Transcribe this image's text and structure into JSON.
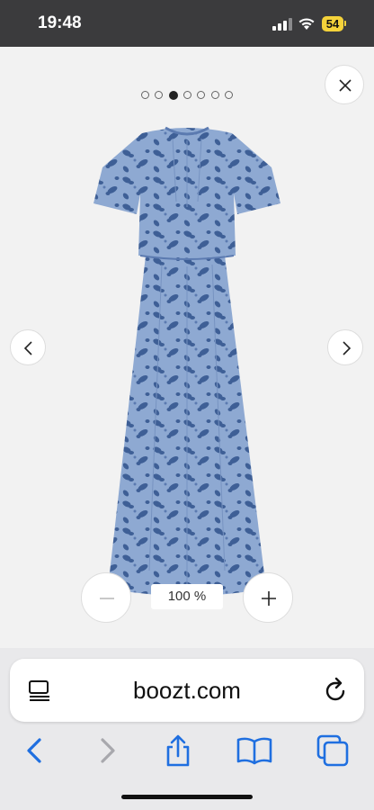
{
  "status_bar": {
    "time": "19:48",
    "battery_level": "54",
    "battery_color": "#f4d23a"
  },
  "gallery": {
    "image_count": 7,
    "active_index": 2,
    "image_alt": "Blue floral midi dress",
    "icons": {
      "close": "close-icon",
      "prev": "chevron-left-icon",
      "next": "chevron-right-icon"
    },
    "dress_colors": {
      "base": "#8ea9d2",
      "print": "#3e5f96"
    }
  },
  "zoom": {
    "level": "100 %",
    "minus_icon": "minus-icon",
    "plus_icon": "plus-icon"
  },
  "browser": {
    "url": "boozt.com",
    "icons": {
      "reader": "reader-icon",
      "reload": "reload-icon",
      "back": "back-arrow-icon",
      "forward": "forward-arrow-icon",
      "share": "share-icon",
      "bookmarks": "bookmarks-icon",
      "tabs": "tabs-icon"
    },
    "accent_color": "#1f6fe0"
  }
}
